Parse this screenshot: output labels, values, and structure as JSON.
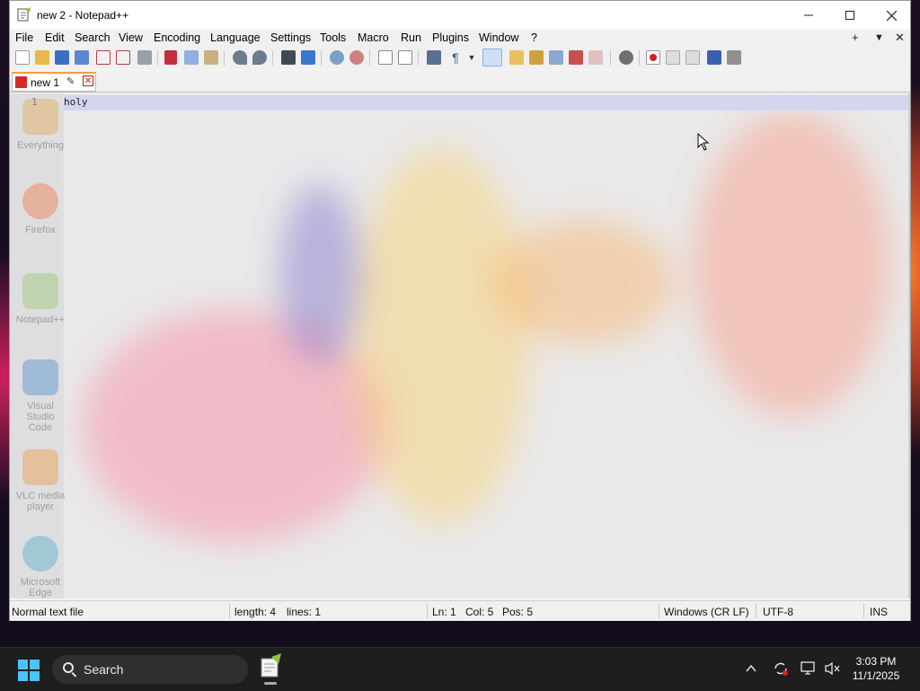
{
  "window": {
    "title": "new 2 - Notepad++"
  },
  "menu": [
    "File",
    "Edit",
    "Search",
    "View",
    "Encoding",
    "Language",
    "Settings",
    "Tools",
    "Macro",
    "Run",
    "Plugins",
    "Window",
    "?"
  ],
  "menu_right": {
    "add": "+",
    "dropdown": "▼",
    "close": "✕"
  },
  "tab": {
    "label": "new 1"
  },
  "editor": {
    "line_number": "1",
    "content": "holy"
  },
  "status": {
    "file_type": "Normal text file",
    "length": "length: 4",
    "lines": "lines: 1",
    "ln": "Ln: 1",
    "col": "Col: 5",
    "pos": "Pos: 5",
    "eol": "Windows (CR LF)",
    "encoding": "UTF-8",
    "mode": "INS"
  },
  "desktop_icons": [
    "Everything",
    "Firefox",
    "Notepad++",
    "Visual Studio Code",
    "VLC media player",
    "Microsoft Edge"
  ],
  "taskbar": {
    "search_label": "Search",
    "time": "3:03 PM",
    "date": "11/1/2025"
  },
  "colors": {
    "accent": "#4cc2ff",
    "tab_highlight": "#f0a040",
    "current_line": "#d5d5ee"
  }
}
